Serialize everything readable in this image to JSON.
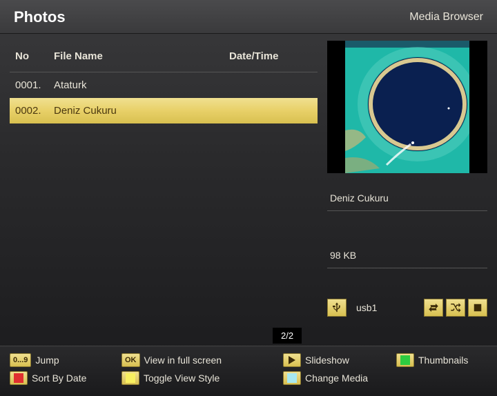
{
  "header": {
    "title": "Photos",
    "subtitle": "Media Browser"
  },
  "list": {
    "columns": {
      "no": "No",
      "name": "File Name",
      "date": "Date/Time"
    },
    "items": [
      {
        "no": "0001.",
        "name": "Ataturk",
        "date": ""
      },
      {
        "no": "0002.",
        "name": "Deniz Cukuru",
        "date": ""
      }
    ],
    "page": "2/2"
  },
  "preview": {
    "title": "Deniz Cukuru",
    "size": "98 KB",
    "source": "usb1"
  },
  "footer": {
    "row1": {
      "jump": {
        "key": "0...9",
        "label": "Jump"
      },
      "ok": {
        "key": "OK",
        "label": "View in full screen"
      },
      "slideshow": {
        "label": "Slideshow"
      },
      "thumbnails": {
        "label": "Thumbnails",
        "color": "#2ecc40"
      }
    },
    "row2": {
      "sort": {
        "label": "Sort By Date",
        "color": "#e03030"
      },
      "toggle": {
        "label": "Toggle View Style",
        "color": "#f8f060"
      },
      "media": {
        "label": "Change Media",
        "color": "#a8e8f0"
      }
    }
  }
}
